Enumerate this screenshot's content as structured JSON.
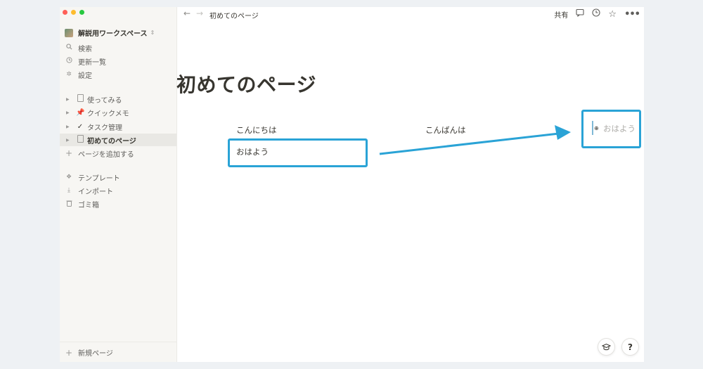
{
  "sidebar": {
    "workspace": "解説用ワークスペース",
    "nav": [
      {
        "label": "検索",
        "icon": "search-icon"
      },
      {
        "label": "更新一覧",
        "icon": "clock-icon"
      },
      {
        "label": "設定",
        "icon": "gear-icon"
      }
    ],
    "pages": [
      {
        "label": "使ってみる",
        "icon": "doc-icon"
      },
      {
        "label": "クイックメモ",
        "icon": "pin-icon"
      },
      {
        "label": "タスク管理",
        "icon": "check-icon"
      },
      {
        "label": "初めてのページ",
        "icon": "doc-icon"
      }
    ],
    "add_page": "ページを追加する",
    "tools": [
      {
        "label": "テンプレート",
        "icon": "template-icon"
      },
      {
        "label": "インポート",
        "icon": "import-icon"
      },
      {
        "label": "ゴミ箱",
        "icon": "trash-icon"
      }
    ],
    "new_page": "新規ページ"
  },
  "topbar": {
    "breadcrumb": "初めてのページ",
    "share": "共有"
  },
  "page": {
    "title": "初めてのページ",
    "columns": [
      {
        "heading": "こんにちは",
        "item": "おはよう"
      },
      {
        "heading": "こんばんは"
      },
      {
        "placeholder": "おはよう"
      }
    ]
  },
  "colors": {
    "highlight": "#2aa3d6",
    "sidebar_bg": "#f7f6f3",
    "text": "#37352f"
  }
}
